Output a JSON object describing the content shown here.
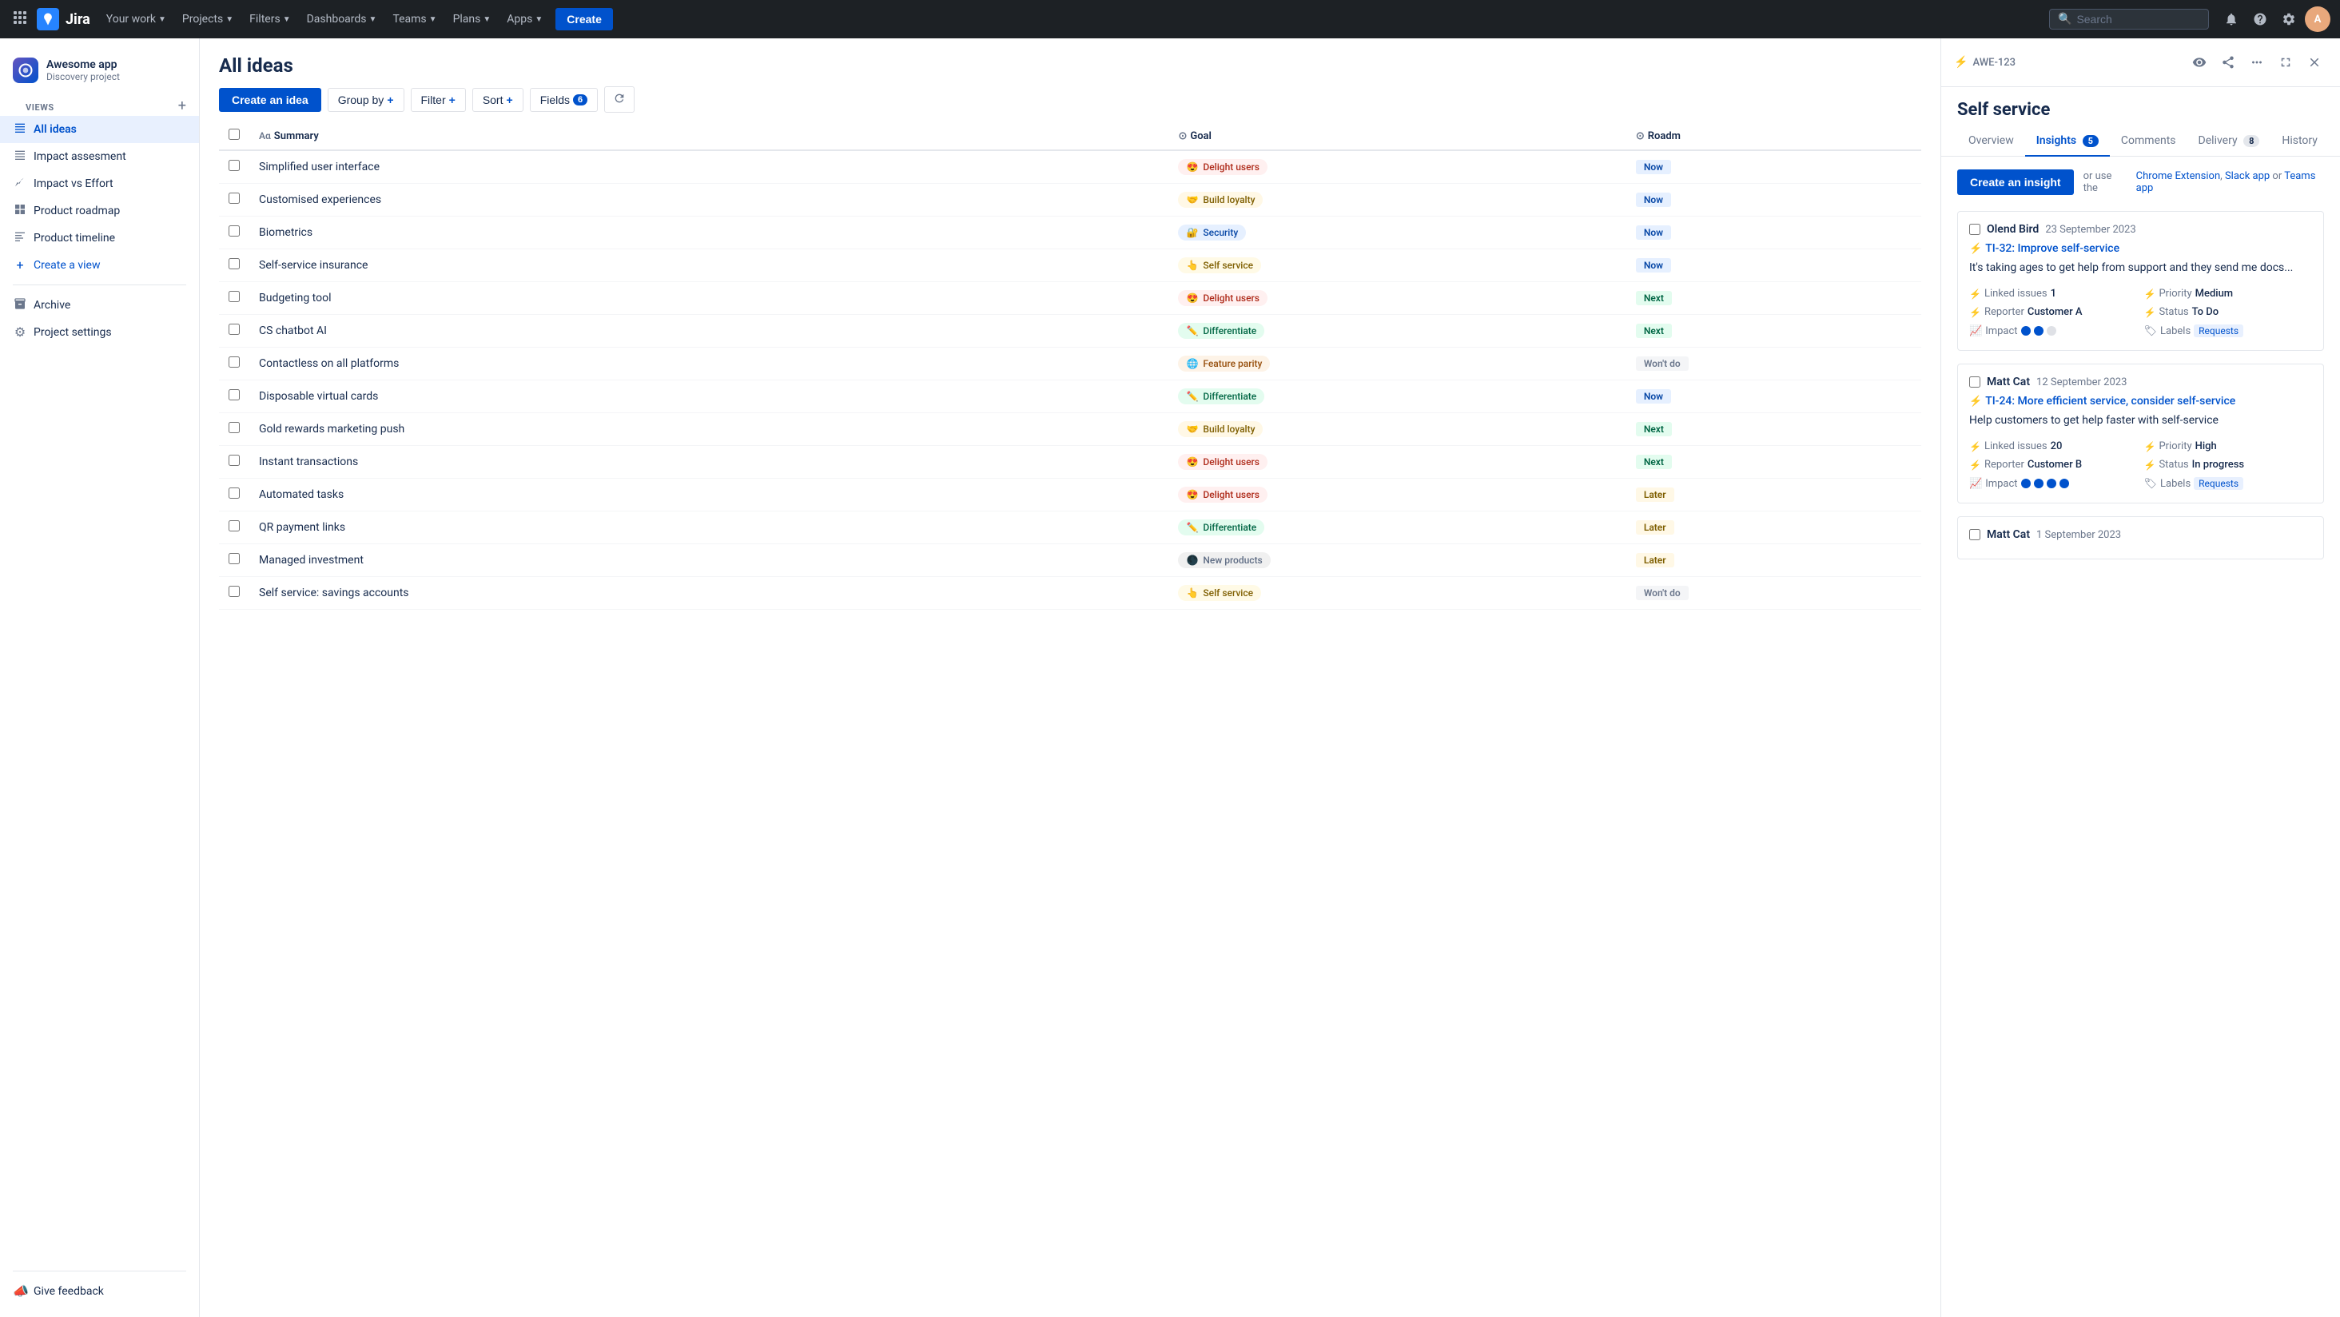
{
  "topnav": {
    "logo_text": "Jira",
    "your_work": "Your work",
    "projects": "Projects",
    "filters": "Filters",
    "dashboards": "Dashboards",
    "teams": "Teams",
    "plans": "Plans",
    "apps": "Apps",
    "create": "Create",
    "search_placeholder": "Search"
  },
  "sidebar": {
    "project_name": "Awesome app",
    "project_type": "Discovery project",
    "views_label": "VIEWS",
    "add_view_title": "+",
    "items": [
      {
        "id": "all-ideas",
        "label": "All ideas",
        "icon": "≡",
        "active": true
      },
      {
        "id": "impact-assessment",
        "label": "Impact assesment",
        "icon": "≡",
        "active": false
      },
      {
        "id": "impact-vs-effort",
        "label": "Impact vs Effort",
        "icon": "📊",
        "active": false
      },
      {
        "id": "product-roadmap",
        "label": "Product roadmap",
        "icon": "⊞",
        "active": false
      },
      {
        "id": "product-timeline",
        "label": "Product timeline",
        "icon": "≡",
        "active": false
      },
      {
        "id": "create-view",
        "label": "Create a view",
        "icon": "+",
        "active": false
      }
    ],
    "archive": "Archive",
    "project_settings": "Project settings",
    "give_feedback": "Give feedback"
  },
  "main": {
    "title": "All ideas",
    "toolbar": {
      "create_idea": "Create an idea",
      "group_by": "Group by",
      "filter": "Filter",
      "sort": "Sort",
      "fields": "Fields",
      "fields_count": "6"
    },
    "table": {
      "columns": [
        "Summary",
        "Goal",
        "Roadm"
      ],
      "rows": [
        {
          "summary": "Simplified user interface",
          "goal_label": "Delight users",
          "goal_emoji": "😍",
          "goal_class": "goal-delight",
          "road_label": "Now",
          "road_class": "road-now"
        },
        {
          "summary": "Customised experiences",
          "goal_label": "Build loyalty",
          "goal_emoji": "🤝",
          "goal_class": "goal-loyalty",
          "road_label": "Now",
          "road_class": "road-now"
        },
        {
          "summary": "Biometrics",
          "goal_label": "Security",
          "goal_emoji": "🔐",
          "goal_class": "goal-security",
          "road_label": "Now",
          "road_class": "road-now"
        },
        {
          "summary": "Self-service insurance",
          "goal_label": "Self service",
          "goal_emoji": "👆",
          "goal_class": "goal-self",
          "road_label": "Now",
          "road_class": "road-now"
        },
        {
          "summary": "Budgeting tool",
          "goal_label": "Delight users",
          "goal_emoji": "😍",
          "goal_class": "goal-delight",
          "road_label": "Next",
          "road_class": "road-next"
        },
        {
          "summary": "CS chatbot AI",
          "goal_label": "Differentiate",
          "goal_emoji": "✏️",
          "goal_class": "goal-diff",
          "road_label": "Next",
          "road_class": "road-next"
        },
        {
          "summary": "Contactless on all platforms",
          "goal_label": "Feature parity",
          "goal_emoji": "🌐",
          "goal_class": "goal-feature",
          "road_label": "Won't do",
          "road_class": "road-wont"
        },
        {
          "summary": "Disposable virtual cards",
          "goal_label": "Differentiate",
          "goal_emoji": "✏️",
          "goal_class": "goal-diff",
          "road_label": "Now",
          "road_class": "road-now"
        },
        {
          "summary": "Gold rewards marketing push",
          "goal_label": "Build loyalty",
          "goal_emoji": "🤝",
          "goal_class": "goal-loyalty",
          "road_label": "Next",
          "road_class": "road-next"
        },
        {
          "summary": "Instant transactions",
          "goal_label": "Delight users",
          "goal_emoji": "😍",
          "goal_class": "goal-delight",
          "road_label": "Next",
          "road_class": "road-next"
        },
        {
          "summary": "Automated tasks",
          "goal_label": "Delight users",
          "goal_emoji": "😍",
          "goal_class": "goal-delight",
          "road_label": "Later",
          "road_class": "road-later"
        },
        {
          "summary": "QR payment links",
          "goal_label": "Differentiate",
          "goal_emoji": "✏️",
          "goal_class": "goal-diff",
          "road_label": "Later",
          "road_class": "road-later"
        },
        {
          "summary": "Managed investment",
          "goal_label": "New products",
          "goal_emoji": "🌑",
          "goal_class": "goal-new",
          "road_label": "Later",
          "road_class": "road-later"
        },
        {
          "summary": "Self service: savings accounts",
          "goal_label": "Self service",
          "goal_emoji": "👆",
          "goal_class": "goal-self",
          "road_label": "Won't do",
          "road_class": "road-wont"
        }
      ]
    }
  },
  "detail": {
    "issue_id": "AWE-123",
    "title": "Self service",
    "tabs": [
      {
        "id": "overview",
        "label": "Overview",
        "badge": null,
        "active": false
      },
      {
        "id": "insights",
        "label": "Insights",
        "badge": "5",
        "active": true
      },
      {
        "id": "comments",
        "label": "Comments",
        "badge": null,
        "active": false
      },
      {
        "id": "delivery",
        "label": "Delivery",
        "badge": "8",
        "active": false
      },
      {
        "id": "history",
        "label": "History",
        "badge": null,
        "active": false
      }
    ],
    "create_insight_btn": "Create an insight",
    "create_insight_or": "or use the",
    "create_insight_links": "Chrome Extension, Slack app or Teams app",
    "insights": [
      {
        "author": "Olend Bird",
        "date": "23 September 2023",
        "link_id": "TI-32",
        "link_text": "TI-32: Improve self-service",
        "description": "It's taking ages to get help from support and they send me docs...",
        "linked_issues": "1",
        "priority": "Medium",
        "reporter": "Customer A",
        "status": "To Do",
        "impact_dots": 2,
        "labels": "Requests"
      },
      {
        "author": "Matt Cat",
        "date": "12 September 2023",
        "link_id": "TI-24",
        "link_text": "TI-24: More efficient service, consider self-service",
        "description": "Help customers to get help faster with self-service",
        "linked_issues": "20",
        "priority": "High",
        "reporter": "Customer B",
        "status": "In progress",
        "impact_dots": 4,
        "labels": "Requests"
      },
      {
        "author": "Matt Cat",
        "date": "1 September 2023",
        "link_id": null,
        "link_text": null,
        "description": "",
        "linked_issues": null,
        "priority": null,
        "reporter": null,
        "status": null,
        "impact_dots": 0,
        "labels": null
      }
    ]
  }
}
